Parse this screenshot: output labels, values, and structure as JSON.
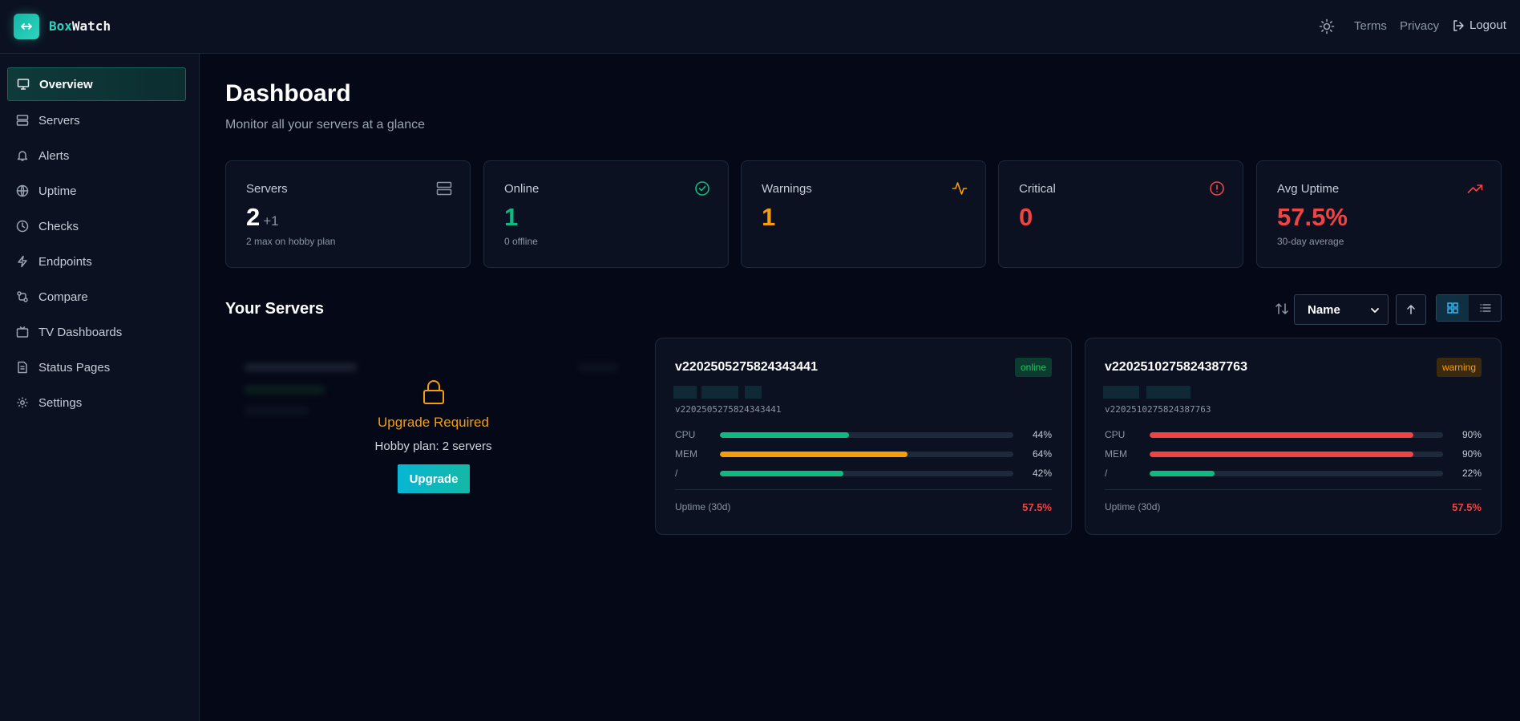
{
  "app": {
    "brand_part1": "Box",
    "brand_part2": "Watch"
  },
  "header": {
    "terms": "Terms",
    "privacy": "Privacy",
    "logout": "Logout"
  },
  "sidebar": {
    "items": [
      {
        "label": "Overview",
        "icon": "monitor-icon",
        "active": true
      },
      {
        "label": "Servers",
        "icon": "server-icon"
      },
      {
        "label": "Alerts",
        "icon": "bell-icon"
      },
      {
        "label": "Uptime",
        "icon": "globe-icon"
      },
      {
        "label": "Checks",
        "icon": "clock-icon"
      },
      {
        "label": "Endpoints",
        "icon": "zap-icon"
      },
      {
        "label": "Compare",
        "icon": "compare-icon"
      },
      {
        "label": "TV Dashboards",
        "icon": "tv-icon"
      },
      {
        "label": "Status Pages",
        "icon": "file-icon"
      },
      {
        "label": "Settings",
        "icon": "gear-icon"
      }
    ]
  },
  "main": {
    "title": "Dashboard",
    "subtitle": "Monitor all your servers at a glance"
  },
  "stats": [
    {
      "label": "Servers",
      "value": "2",
      "extra": "+1",
      "note": "2 max on hobby plan",
      "color": "#ffffff",
      "icon": "server-stack-icon"
    },
    {
      "label": "Online",
      "value": "1",
      "note": "0 offline",
      "color": "#10b981",
      "icon": "check-circle-icon"
    },
    {
      "label": "Warnings",
      "value": "1",
      "note": "",
      "color": "#f59e0b",
      "icon": "activity-icon"
    },
    {
      "label": "Critical",
      "value": "0",
      "note": "",
      "color": "#ef4444",
      "icon": "alert-circle-icon"
    },
    {
      "label": "Avg Uptime",
      "value": "57.5%",
      "note": "30-day average",
      "color": "#ef4444",
      "icon": "trending-up-icon"
    }
  ],
  "servers_section": {
    "title": "Your Servers",
    "sort_value": "Name"
  },
  "locked": {
    "title": "Upgrade Required",
    "subtitle": "Hobby plan: 2 servers",
    "button": "Upgrade"
  },
  "servers": [
    {
      "name": "v2202505275824343441",
      "host": "v2202505275824343441",
      "status": "online",
      "metrics": [
        {
          "label": "CPU",
          "pct": "44%",
          "value": 44,
          "color": "#10b981"
        },
        {
          "label": "MEM",
          "pct": "64%",
          "value": 64,
          "color": "#f59e0b"
        },
        {
          "label": "/",
          "pct": "42%",
          "value": 42,
          "color": "#10b981"
        }
      ],
      "uptime_label": "Uptime (30d)",
      "uptime": "57.5%"
    },
    {
      "name": "v2202510275824387763",
      "host": "v2202510275824387763",
      "status": "warning",
      "metrics": [
        {
          "label": "CPU",
          "pct": "90%",
          "value": 90,
          "color": "#ef4444"
        },
        {
          "label": "MEM",
          "pct": "90%",
          "value": 90,
          "color": "#ef4444"
        },
        {
          "label": "/",
          "pct": "22%",
          "value": 22,
          "color": "#10b981"
        }
      ],
      "uptime_label": "Uptime (30d)",
      "uptime": "57.5%"
    }
  ]
}
